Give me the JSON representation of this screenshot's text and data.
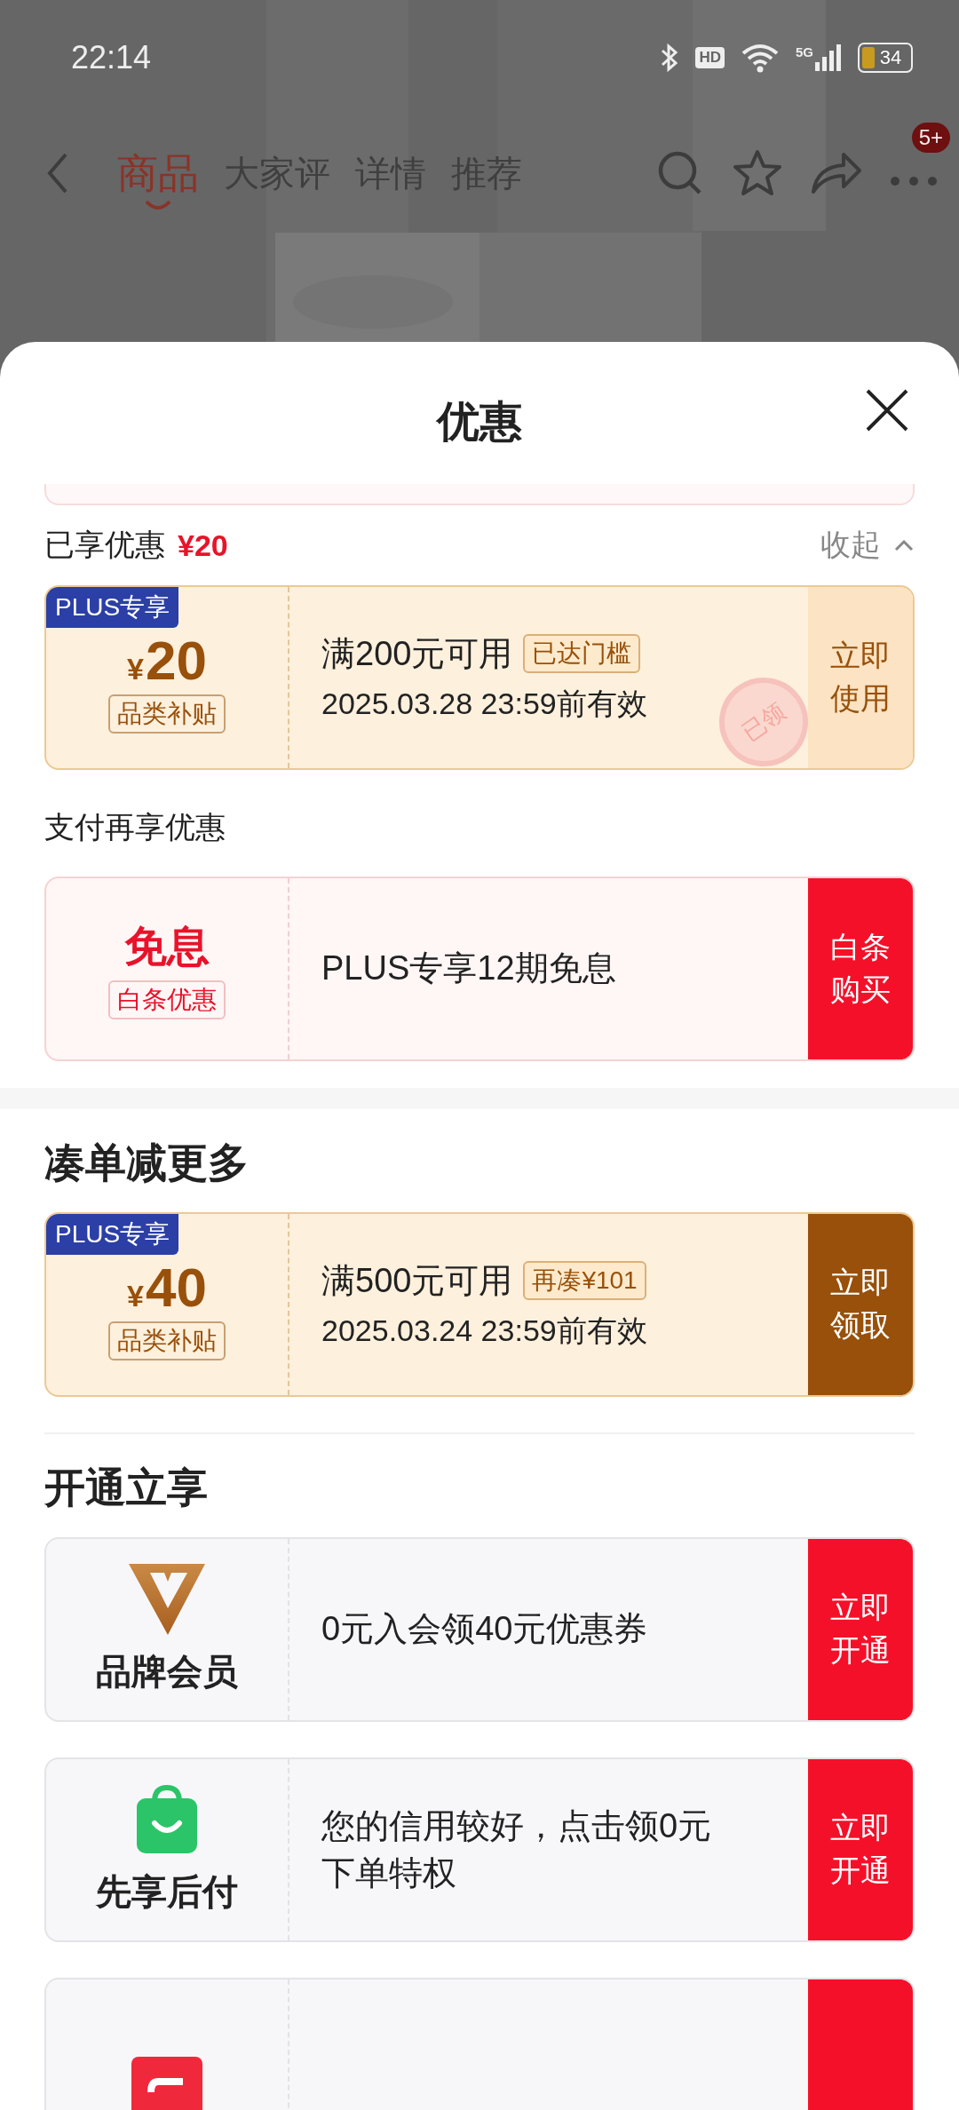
{
  "status_bar": {
    "time": "22:14",
    "hd": "HD",
    "network": "5G",
    "battery": "34"
  },
  "nav": {
    "tabs": [
      {
        "label": "商品",
        "selected": true
      },
      {
        "label": "大家评",
        "selected": false
      },
      {
        "label": "详情",
        "selected": false
      },
      {
        "label": "推荐",
        "selected": false
      }
    ],
    "badge": "5+"
  },
  "sheet": {
    "title": "优惠",
    "enjoyed": {
      "label": "已享优惠",
      "amount": "¥20",
      "toggle": "收起"
    },
    "enjoyed_coupons": [
      {
        "kind": "coupon",
        "tag": "PLUS专享",
        "currency": "¥",
        "amount": "20",
        "category": "品类补贴",
        "condition": "满200元可用",
        "badge": "已达门槛",
        "validity": "2025.03.28 23:59前有效",
        "action": "立即使用",
        "claimed": true,
        "stamp": "已领"
      }
    ],
    "pay_label": "支付再享优惠",
    "pay_offers": [
      {
        "kind": "offer",
        "headline": "免息",
        "sub": "白条优惠",
        "text": "PLUS专享12期免息",
        "action": "白条购买"
      }
    ],
    "sections": [
      {
        "title": "凑单减更多",
        "items": [
          {
            "kind": "coupon",
            "tag": "PLUS专享",
            "currency": "¥",
            "amount": "40",
            "category": "品类补贴",
            "condition": "满500元可用",
            "badge": "再凑¥101",
            "validity": "2025.03.24 23:59前有效",
            "action": "立即领取",
            "claimed": false
          }
        ]
      },
      {
        "title": "开通立享",
        "items": [
          {
            "kind": "membership",
            "name": "品牌会员",
            "text": "0元入会领40元优惠券",
            "action": "立即开通"
          },
          {
            "kind": "membership",
            "name": "先享后付",
            "text": "您的信用较好，点击领0元下单特权",
            "action": "立即开通"
          },
          {
            "kind": "membership"
          }
        ]
      }
    ]
  }
}
